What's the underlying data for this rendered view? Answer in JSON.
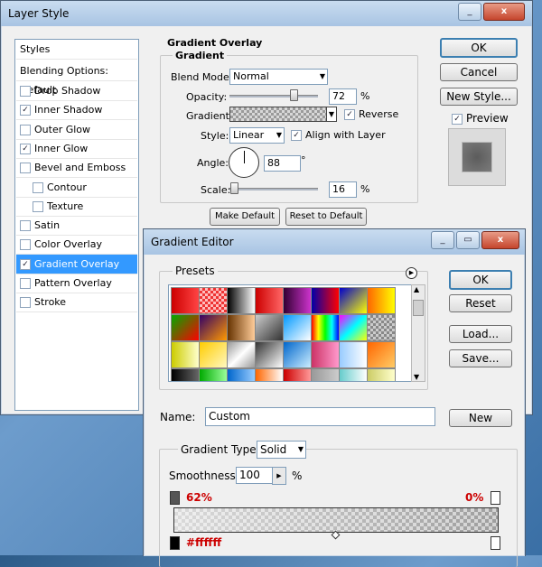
{
  "layer_style": {
    "title": "Layer Style",
    "styles_header": "Styles",
    "blending_label": "Blending Options: Default",
    "items": [
      {
        "label": "Drop Shadow",
        "checked": false,
        "indent": false
      },
      {
        "label": "Inner Shadow",
        "checked": true,
        "indent": false
      },
      {
        "label": "Outer Glow",
        "checked": false,
        "indent": false
      },
      {
        "label": "Inner Glow",
        "checked": true,
        "indent": false
      },
      {
        "label": "Bevel and Emboss",
        "checked": false,
        "indent": false
      },
      {
        "label": "Contour",
        "checked": false,
        "indent": true
      },
      {
        "label": "Texture",
        "checked": false,
        "indent": true
      },
      {
        "label": "Satin",
        "checked": false,
        "indent": false
      },
      {
        "label": "Color Overlay",
        "checked": false,
        "indent": false
      },
      {
        "label": "Gradient Overlay",
        "checked": true,
        "indent": false,
        "selected": true
      },
      {
        "label": "Pattern Overlay",
        "checked": false,
        "indent": false
      },
      {
        "label": "Stroke",
        "checked": false,
        "indent": false
      }
    ],
    "section_title": "Gradient Overlay",
    "group_title": "Gradient",
    "blend_mode_label": "Blend Mode:",
    "blend_mode_value": "Normal",
    "opacity_label": "Opacity:",
    "opacity_value": "72",
    "percent": "%",
    "gradient_label": "Gradient:",
    "reverse_label": "Reverse",
    "style_label": "Style:",
    "style_value": "Linear",
    "align_label": "Align with Layer",
    "angle_label": "Angle:",
    "angle_value": "88",
    "degree": "°",
    "scale_label": "Scale:",
    "scale_value": "16",
    "make_default": "Make Default",
    "reset_default": "Reset to Default",
    "ok": "OK",
    "cancel": "Cancel",
    "new_style": "New Style...",
    "preview_label": "Preview",
    "controls": {
      "min": "_",
      "restore": "▭",
      "close": "x"
    }
  },
  "gradient_editor": {
    "title": "Gradient Editor",
    "presets_label": "Presets",
    "ok": "OK",
    "reset": "Reset",
    "load": "Load...",
    "save": "Save...",
    "name_label": "Name:",
    "name_value": "Custom",
    "new_btn": "New",
    "gradient_type_label": "Gradient Type:",
    "gradient_type_value": "Solid",
    "smoothness_label": "Smoothness:",
    "smoothness_value": "100",
    "percent": "%",
    "opacity_stop_left": "62%",
    "opacity_stop_right": "0%",
    "color_stop_value": "#ffffff",
    "controls": {
      "min": "_",
      "restore": "▭",
      "close": "x"
    },
    "accent_red": "#cc0000"
  }
}
